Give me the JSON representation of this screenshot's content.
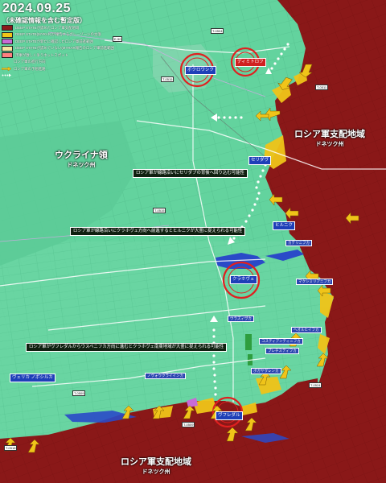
{
  "header": {
    "date": "2024.09.25",
    "subtitle": "（未確認情報を含む暫定版）"
  },
  "legend": [
    {
      "label": "DEEP STATEが認めたロシア軍支配地域",
      "color": "#8b1a1a",
      "type": "swatch"
    },
    {
      "label": "DEEP STATE(MYRAR)が報告するグレーゾーンの主張",
      "color": "#f0c419",
      "type": "swatch"
    },
    {
      "label": "DEEP STATEが新たに確認したロシア軍前進範囲",
      "color": "#c86bd6",
      "type": "swatch"
    },
    {
      "label": "DEEP STATEが認めていない(MYRAR報告のロシア軍前進範囲",
      "color": "#f5e6a0",
      "type": "swatch"
    },
    {
      "label": "両軍が激しく争うホットスポット",
      "color": "#ff8080",
      "type": "swatch"
    },
    {
      "label": "ロシア軍の進行方向",
      "color": "#f0c419",
      "type": "arrow"
    },
    {
      "label": "ロシア軍の予想進路",
      "color": "#ffffff",
      "type": "dots"
    }
  ],
  "towns": [
    {
      "id": "pokrovsk",
      "label": "ポクロウシク",
      "style": "blue"
    },
    {
      "id": "dymytrov",
      "label": "ディミトロフ",
      "style": "red"
    },
    {
      "id": "selydove",
      "label": "セリダヴ",
      "style": "blue"
    },
    {
      "id": "hirnyk",
      "label": "ヒルニク",
      "style": "blue"
    },
    {
      "id": "kurakhove",
      "label": "クラホヴェ",
      "style": "blue"
    },
    {
      "id": "velyka-novosilka",
      "label": "ヴェリカ ノボシルカ",
      "style": "blue"
    },
    {
      "id": "vuhledar",
      "label": "ヴフレダル",
      "style": "blue"
    }
  ],
  "small_towns": [
    {
      "id": "st1",
      "label": "ウラズィヴカ"
    },
    {
      "id": "st2",
      "label": "ボガヤヴレンカ"
    },
    {
      "id": "st3",
      "label": "ノヴォウクライインカ"
    },
    {
      "id": "st4",
      "label": "コスティアンティニフカ"
    },
    {
      "id": "st5",
      "label": "マクシミリアニフカ"
    },
    {
      "id": "st6",
      "label": "ヘオルヒイフカ"
    },
    {
      "id": "st7",
      "label": "カテリニフカ"
    },
    {
      "id": "st8",
      "label": "プレチスティフカ"
    }
  ],
  "regions": [
    {
      "id": "ukraine",
      "line1": "ウクライナ領",
      "line2": "ドネツク州"
    },
    {
      "id": "russia-east",
      "line1": "ロシア軍支配地域",
      "line2": "ドネツク州"
    },
    {
      "id": "russia-south",
      "line1": "ロシア軍支配地域",
      "line2": "ドネツク州"
    }
  ],
  "annotations": [
    {
      "id": "a1",
      "text": "ロシア軍が線路沿いにセリダブの背後へ回り込む可能性"
    },
    {
      "id": "a2",
      "text": "ロシア軍が線路沿いにクラホヴェ方向へ前進するとヒルニクが大釜に捉えられる可能性"
    },
    {
      "id": "a3",
      "text": "ロシア軍がヴフレダルからウスペニフカ方向に進むとクラホヴェ南東地域が大釜に捉えられる可能性"
    }
  ],
  "roads": [
    {
      "id": "r1",
      "label": "T-0504"
    },
    {
      "id": "r2",
      "label": "T-0515"
    },
    {
      "id": "r3",
      "label": "T-0511"
    },
    {
      "id": "r4",
      "label": "T-0515"
    },
    {
      "id": "r5",
      "label": "T-0524"
    },
    {
      "id": "r6",
      "label": "T-0509"
    },
    {
      "id": "r7",
      "label": "T-0518"
    },
    {
      "id": "r8",
      "label": "T-0509"
    },
    {
      "id": "r9",
      "label": "E-50"
    }
  ]
}
